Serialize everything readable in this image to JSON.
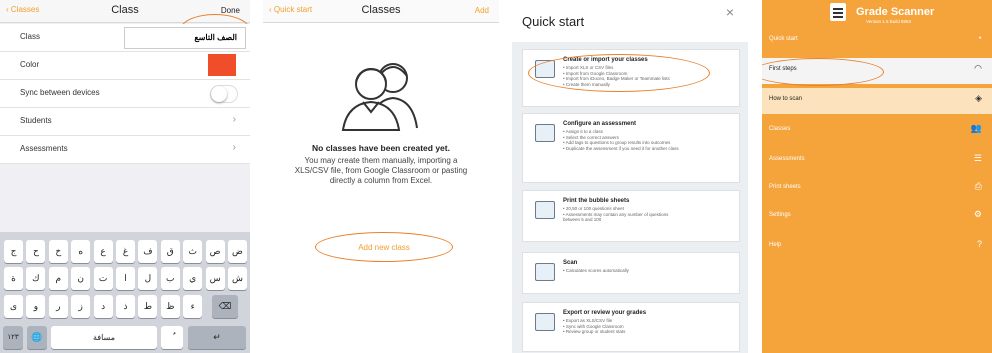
{
  "class_form": {
    "nav": {
      "back": "Classes",
      "title": "Class",
      "done": "Done"
    },
    "rows": {
      "class_label": "Class",
      "class_value": "الصف التاسع",
      "color_label": "Color",
      "color_value": "#f04e2a",
      "sync_label": "Sync between devices",
      "students_label": "Students",
      "assessments_label": "Assessments"
    },
    "keyboard": {
      "row1": [
        "ض",
        "ص",
        "ث",
        "ق",
        "ف",
        "غ",
        "ع",
        "ه",
        "خ",
        "ح",
        "ج"
      ],
      "row2": [
        "ش",
        "س",
        "ي",
        "ب",
        "ل",
        "ا",
        "ت",
        "ن",
        "م",
        "ك",
        "ة"
      ],
      "row3": [
        "ء",
        "ظ",
        "ط",
        "ذ",
        "د",
        "ز",
        "ر",
        "و",
        "ى"
      ],
      "numbers": "١٢٣",
      "space": "مسافة",
      "globe": "🌐",
      "mic": "ٌ",
      "backspace": "⌫",
      "return": "↵"
    }
  },
  "classes": {
    "nav": {
      "back": "Quick start",
      "title": "Classes",
      "add": "Add"
    },
    "empty_title": "No classes have been created yet.",
    "empty_body": "You may create them manually, importing a XLS/CSV file, from Google Classroom or pasting directly a column from Excel.",
    "add_button": "Add new class"
  },
  "quick_start": {
    "title": "Quick start",
    "close": "×",
    "cards": [
      {
        "title": "Create or import your classes",
        "lines": [
          "• Import XLS or CSV files",
          "• Import from Google Classroom",
          "• Import from iDoceo, Badge Maker or Teammate lists",
          "• Create them manually"
        ]
      },
      {
        "title": "Configure an assessment",
        "lines": [
          "• Assign it to a class",
          "• Select the correct answers",
          "• Add tags to questions to group results into outcomes",
          "• Duplicate the assessment if you need it for another class"
        ]
      },
      {
        "title": "Print the bubble sheets",
        "lines": [
          "• 20,50 or 100 questions sheet",
          "• Assessments may contain any number of questions",
          "between 5 and 100"
        ]
      },
      {
        "title": "Scan",
        "lines": [
          "• Calculates scores automatically"
        ]
      },
      {
        "title": "Export or review your grades",
        "lines": [
          "• Export as XLS/CSV file",
          "• Sync with Google Classroom",
          "• Review group or student stats"
        ]
      }
    ]
  },
  "menu": {
    "app_name": "Grade Scanner",
    "version": "Version 1.5 Build 8883",
    "items": [
      {
        "label": "Quick start",
        "icon": "◔"
      },
      {
        "label": "First steps",
        "icon": "◠"
      },
      {
        "label": "How to scan",
        "icon": "◈"
      },
      {
        "label": "Classes",
        "icon": "👥"
      },
      {
        "label": "Assessments",
        "icon": "☰"
      },
      {
        "label": "Print sheets",
        "icon": "⎙"
      },
      {
        "label": "Settings",
        "icon": "⚙"
      },
      {
        "label": "Help",
        "icon": "?"
      }
    ],
    "accent": "#f5a33b"
  }
}
